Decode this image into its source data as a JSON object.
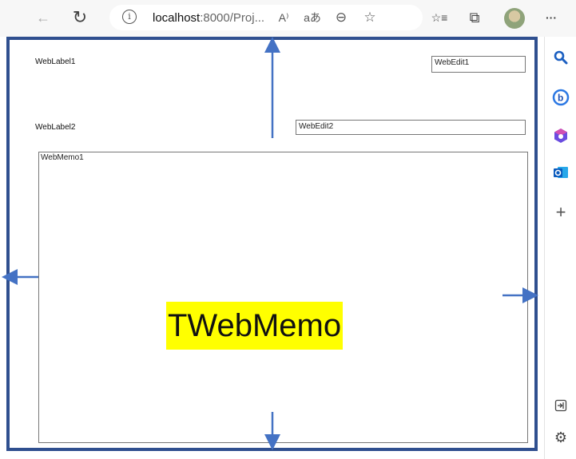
{
  "browser": {
    "url_host": "localhost",
    "url_rest": ":8000/Proj...",
    "buttons": [
      "back-icon",
      "refresh-icon",
      "read-aloud-icon",
      "translate-icon",
      "zoom-out-icon",
      "favorite-add-icon",
      "favorites-icon",
      "collections-icon",
      "profile-avatar",
      "more-icon"
    ],
    "glyphs": {
      "back": "←",
      "refresh": "↻",
      "info": "i",
      "read_aloud": "A⁾",
      "translate": "aあ",
      "zoom": "⊖",
      "fav_add": "☆",
      "favorites": "☆≡",
      "collections": "⧉",
      "more": "···"
    }
  },
  "sidebar": {
    "icons": [
      "search-icon",
      "bing-icon",
      "office-icon",
      "outlook-icon",
      "add-icon",
      "hide-sidebar-icon",
      "settings-icon"
    ],
    "glyphs": {
      "search": "🔍",
      "add": "+",
      "settings": "⚙",
      "hide": "⇥"
    }
  },
  "form": {
    "label1": "WebLabel1",
    "label2": "WebLabel2",
    "edit1": "WebEdit1",
    "edit2": "WebEdit2",
    "memo": "WebMemo1",
    "caption": "TWebMemo"
  },
  "colors": {
    "frame": "#2f4f8f",
    "arrow": "#4472c4",
    "highlight": "#ffff00"
  }
}
